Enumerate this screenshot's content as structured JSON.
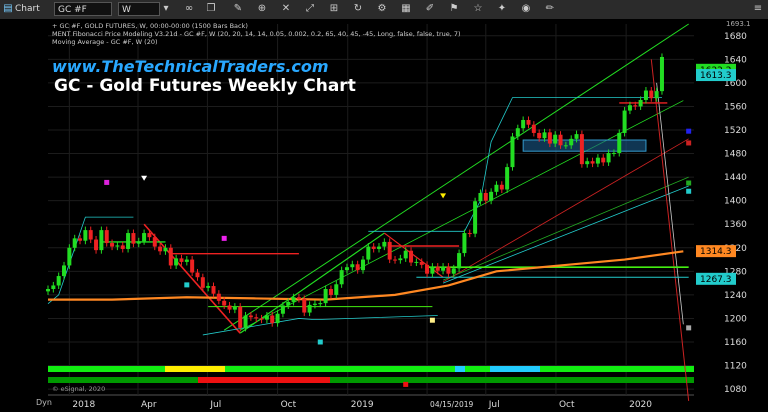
{
  "toolbar": {
    "chart_label": "Chart",
    "symbol": "GC #F",
    "interval": "W",
    "icons": [
      "chart-icon",
      "dropdown-icon",
      "link-icon",
      "copy-icon",
      "tools-icon",
      "pin-icon",
      "close-icon",
      "expand-icon",
      "ruler-icon",
      "refresh-icon",
      "settings-icon",
      "grid-icon",
      "edit-icon",
      "flag-icon",
      "star-icon",
      "twitter-icon",
      "camera-icon",
      "pencil-icon",
      "menu-icon"
    ]
  },
  "chart_info": {
    "line1": "+ GC #F, GOLD FUTURES, W, 00:00-00:00 (1500 Bars Back)",
    "line2": "MENT Fibonacci Price Modeling V3.21d - GC #F, W (20, 20, 14, 14, 0.05, 0.002, 0.2, 65, 40, 45, -45, Long, false, false, true, 7)",
    "line3": "Moving Average - GC #F, W (20)",
    "watermark_url": "www.TheTechnicalTraders.com",
    "title": "GC - Gold Futures Weekly Chart",
    "footer": "© eSignal, 2020",
    "dyn_label": "Dyn",
    "corner_value": "1693.1"
  },
  "chart_data": {
    "type": "candlestick",
    "instrument": "GC #F, GOLD FUTURES, W",
    "ylim": [
      1070,
      1700
    ],
    "y_ticks": [
      1080,
      1120,
      1160,
      1200,
      1240,
      1280,
      1320,
      1360,
      1400,
      1440,
      1480,
      1520,
      1560,
      1600,
      1640,
      1680
    ],
    "x_ticks": [
      "2018",
      "Apr",
      "Jul",
      "Oct",
      "2019",
      "04/15/2019",
      "Jul",
      "Oct",
      "2020"
    ],
    "x_tick_dates": [
      "2018-01-01",
      "2018-04-01",
      "2018-07-01",
      "2018-10-01",
      "2019-01-01",
      "2019-04-15",
      "2019-07-01",
      "2019-10-01",
      "2020-01-01"
    ],
    "price_labels": [
      {
        "value": 1622.2,
        "text": "1622.2",
        "color": "#22dd22"
      },
      {
        "value": 1613.3,
        "text": "1613.3",
        "color": "#22cccc"
      },
      {
        "value": 1314.3,
        "text": "1314.3",
        "color": "#ff8822"
      },
      {
        "value": 1267.3,
        "text": "1267.3",
        "color": "#22cccc"
      }
    ],
    "close_series": [
      [
        "2017-12-04",
        1250
      ],
      [
        "2017-12-11",
        1256
      ],
      [
        "2017-12-18",
        1272
      ],
      [
        "2017-12-25",
        1290
      ],
      [
        "2018-01-01",
        1320
      ],
      [
        "2018-01-08",
        1336
      ],
      [
        "2018-01-15",
        1332
      ],
      [
        "2018-01-22",
        1350
      ],
      [
        "2018-01-29",
        1334
      ],
      [
        "2018-02-05",
        1316
      ],
      [
        "2018-02-12",
        1350
      ],
      [
        "2018-02-19",
        1328
      ],
      [
        "2018-02-26",
        1322
      ],
      [
        "2018-03-05",
        1324
      ],
      [
        "2018-03-12",
        1318
      ],
      [
        "2018-03-19",
        1345
      ],
      [
        "2018-03-26",
        1327
      ],
      [
        "2018-04-02",
        1331
      ],
      [
        "2018-04-09",
        1345
      ],
      [
        "2018-04-16",
        1338
      ],
      [
        "2018-04-23",
        1322
      ],
      [
        "2018-04-30",
        1314
      ],
      [
        "2018-05-07",
        1320
      ],
      [
        "2018-05-14",
        1290
      ],
      [
        "2018-05-21",
        1302
      ],
      [
        "2018-05-28",
        1296
      ],
      [
        "2018-06-04",
        1300
      ],
      [
        "2018-06-11",
        1278
      ],
      [
        "2018-06-18",
        1270
      ],
      [
        "2018-06-25",
        1252
      ],
      [
        "2018-07-02",
        1255
      ],
      [
        "2018-07-09",
        1242
      ],
      [
        "2018-07-16",
        1230
      ],
      [
        "2018-07-23",
        1222
      ],
      [
        "2018-07-30",
        1215
      ],
      [
        "2018-08-06",
        1220
      ],
      [
        "2018-08-13",
        1184
      ],
      [
        "2018-08-20",
        1205
      ],
      [
        "2018-08-27",
        1202
      ],
      [
        "2018-09-03",
        1200
      ],
      [
        "2018-09-10",
        1198
      ],
      [
        "2018-09-17",
        1205
      ],
      [
        "2018-09-24",
        1192
      ],
      [
        "2018-10-01",
        1208
      ],
      [
        "2018-10-08",
        1222
      ],
      [
        "2018-10-15",
        1228
      ],
      [
        "2018-10-22",
        1236
      ],
      [
        "2018-10-29",
        1233
      ],
      [
        "2018-11-05",
        1210
      ],
      [
        "2018-11-12",
        1223
      ],
      [
        "2018-11-19",
        1225
      ],
      [
        "2018-11-26",
        1226
      ],
      [
        "2018-12-03",
        1250
      ],
      [
        "2018-12-10",
        1240
      ],
      [
        "2018-12-17",
        1258
      ],
      [
        "2018-12-24",
        1282
      ],
      [
        "2018-12-31",
        1287
      ],
      [
        "2019-01-07",
        1292
      ],
      [
        "2019-01-14",
        1282
      ],
      [
        "2019-01-21",
        1300
      ],
      [
        "2019-01-28",
        1322
      ],
      [
        "2019-02-04",
        1318
      ],
      [
        "2019-02-11",
        1322
      ],
      [
        "2019-02-18",
        1330
      ],
      [
        "2019-02-25",
        1300
      ],
      [
        "2019-03-04",
        1299
      ],
      [
        "2019-03-11",
        1302
      ],
      [
        "2019-03-18",
        1315
      ],
      [
        "2019-03-25",
        1295
      ],
      [
        "2019-04-01",
        1296
      ],
      [
        "2019-04-08",
        1291
      ],
      [
        "2019-04-15",
        1276
      ],
      [
        "2019-04-22",
        1288
      ],
      [
        "2019-04-29",
        1281
      ],
      [
        "2019-05-06",
        1288
      ],
      [
        "2019-05-13",
        1276
      ],
      [
        "2019-05-20",
        1285
      ],
      [
        "2019-05-27",
        1311
      ],
      [
        "2019-06-03",
        1345
      ],
      [
        "2019-06-10",
        1344
      ],
      [
        "2019-06-17",
        1399
      ],
      [
        "2019-06-24",
        1413
      ],
      [
        "2019-07-01",
        1400
      ],
      [
        "2019-07-08",
        1415
      ],
      [
        "2019-07-15",
        1427
      ],
      [
        "2019-07-22",
        1419
      ],
      [
        "2019-07-29",
        1457
      ],
      [
        "2019-08-05",
        1509
      ],
      [
        "2019-08-12",
        1523
      ],
      [
        "2019-08-19",
        1537
      ],
      [
        "2019-08-26",
        1529
      ],
      [
        "2019-09-02",
        1515
      ],
      [
        "2019-09-09",
        1506
      ],
      [
        "2019-09-16",
        1516
      ],
      [
        "2019-09-23",
        1497
      ],
      [
        "2019-09-30",
        1512
      ],
      [
        "2019-10-07",
        1494
      ],
      [
        "2019-10-14",
        1494
      ],
      [
        "2019-10-21",
        1505
      ],
      [
        "2019-10-28",
        1513
      ],
      [
        "2019-11-04",
        1462
      ],
      [
        "2019-11-11",
        1467
      ],
      [
        "2019-11-18",
        1463
      ],
      [
        "2019-11-25",
        1473
      ],
      [
        "2019-12-02",
        1465
      ],
      [
        "2019-12-09",
        1481
      ],
      [
        "2019-12-16",
        1481
      ],
      [
        "2019-12-23",
        1515
      ],
      [
        "2019-12-30",
        1553
      ],
      [
        "2020-01-06",
        1562
      ],
      [
        "2020-01-13",
        1560
      ],
      [
        "2020-01-20",
        1571
      ],
      [
        "2020-01-27",
        1587
      ],
      [
        "2020-02-03",
        1574
      ],
      [
        "2020-02-10",
        1586
      ],
      [
        "2020-02-17",
        1644
      ]
    ],
    "moving_average_20": [
      [
        "2017-12-04",
        1232
      ],
      [
        "2018-02-26",
        1232
      ],
      [
        "2018-06-04",
        1236
      ],
      [
        "2018-09-03",
        1234
      ],
      [
        "2018-12-03",
        1232
      ],
      [
        "2019-03-04",
        1240
      ],
      [
        "2019-05-13",
        1256
      ],
      [
        "2019-07-15",
        1280
      ],
      [
        "2019-10-07",
        1290
      ],
      [
        "2019-12-30",
        1300
      ],
      [
        "2020-03-16",
        1314
      ]
    ],
    "annotations": [
      "04/15/2019"
    ]
  },
  "colors": {
    "up": "#22dd22",
    "down": "#ee2222",
    "ma": "#ff8822",
    "cyan": "#22cccc",
    "axis_text": "#dddddd",
    "url": "#29a8ff"
  }
}
